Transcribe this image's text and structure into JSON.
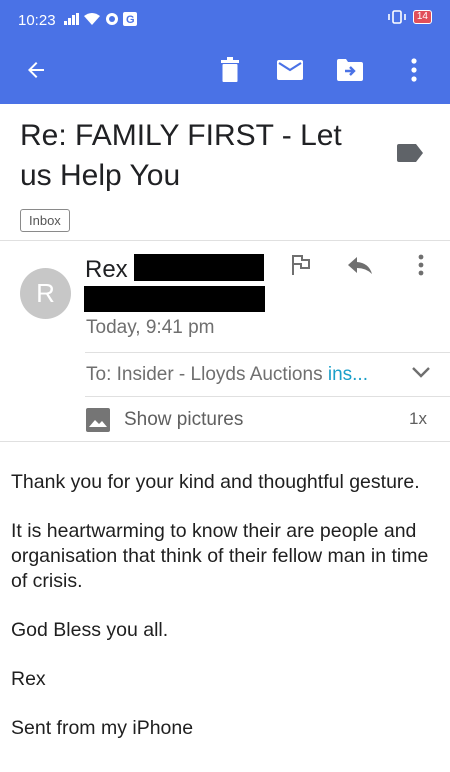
{
  "status_bar": {
    "time": "10:23",
    "battery": "14",
    "color": "#4a72e6"
  },
  "toolbar": {
    "back_icon": "arrow-left-icon",
    "delete_icon": "trash-icon",
    "mark_unread_icon": "mail-icon",
    "move_icon": "move-to-folder-icon",
    "more_icon": "more-vert-icon"
  },
  "email": {
    "subject": "Re: FAMILY FIRST - Let us Help You",
    "folder_label": "Inbox",
    "sender": {
      "initial": "R",
      "name": "Rex",
      "time": "Today, 9:41 pm"
    },
    "recipients": {
      "prefix": "To: Insider - Lloyds Auctions",
      "truncated_address": "ins..."
    },
    "show_pictures": "Show pictures",
    "zoom": "1x",
    "body": [
      "Thank you for your kind and thoughtful gesture.",
      "It is heartwarming to know their are people and organisation that think of their fellow man in time of crisis.",
      "God Bless you all.",
      "Rex",
      "Sent from my iPhone"
    ]
  }
}
